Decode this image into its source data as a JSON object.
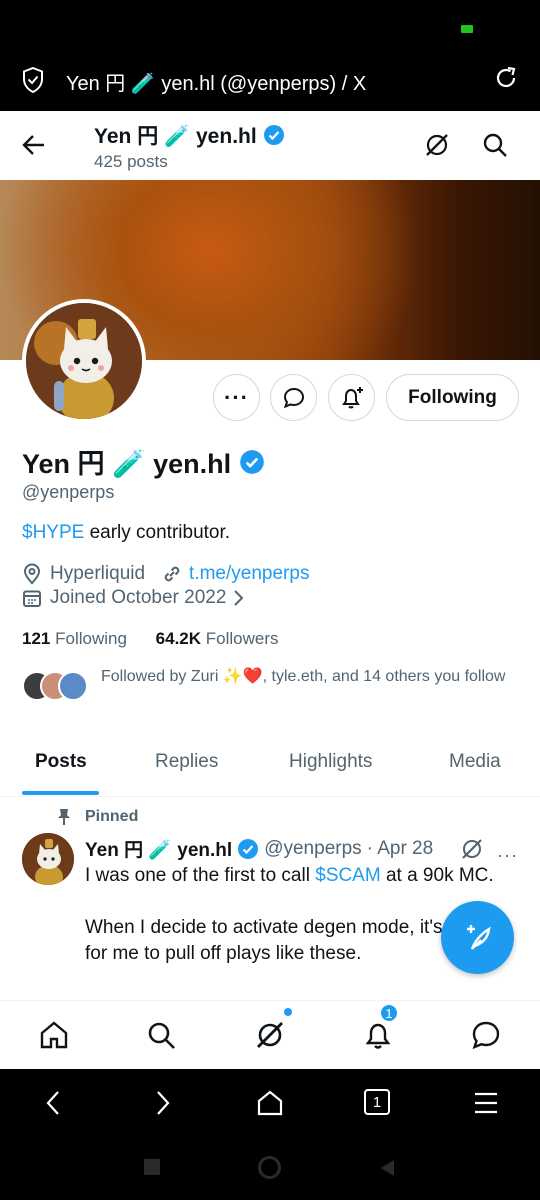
{
  "browser": {
    "tab_title": "Yen 円 🧪 yen.hl (@yenperps) / X"
  },
  "topbar": {
    "name": "Yen 円 🧪 yen.hl",
    "posts_count": "425 posts"
  },
  "profile": {
    "name": "Yen 円 🧪 yen.hl",
    "handle": "@yenperps",
    "bio_cashtag": "$HYPE",
    "bio_rest": " early contributor.",
    "location": "Hyperliquid",
    "website": "t.me/yenperps",
    "joined": "Joined October 2022",
    "following_count": "121",
    "following_label": "Following",
    "followers_count": "64.2K",
    "followers_label": "Followers",
    "followed_by": "Followed by Zuri ✨❤️, tyle.eth, and 14 others you follow",
    "follow_button": "Following"
  },
  "tabs": [
    "Posts",
    "Replies",
    "Highlights",
    "Media"
  ],
  "pinned_tweet": {
    "pinned_label": "Pinned",
    "name": "Yen 円 🧪 yen.hl",
    "handle": "@yenperps",
    "date": "· Apr 28",
    "line1_pre": "I was one of the first to call ",
    "line1_tag": "$SCAM",
    "line1_post": " at a 90k MC.",
    "line2": "When I decide to activate degen mode, it's easy",
    "line3": "for me to pull off plays like these."
  },
  "bottom_nav": {
    "notifications_badge": "1"
  },
  "browser_nav": {
    "tabs_count": "1"
  },
  "colors": {
    "accent": "#1d9bf0",
    "text": "#0f1419",
    "muted": "#536471"
  }
}
